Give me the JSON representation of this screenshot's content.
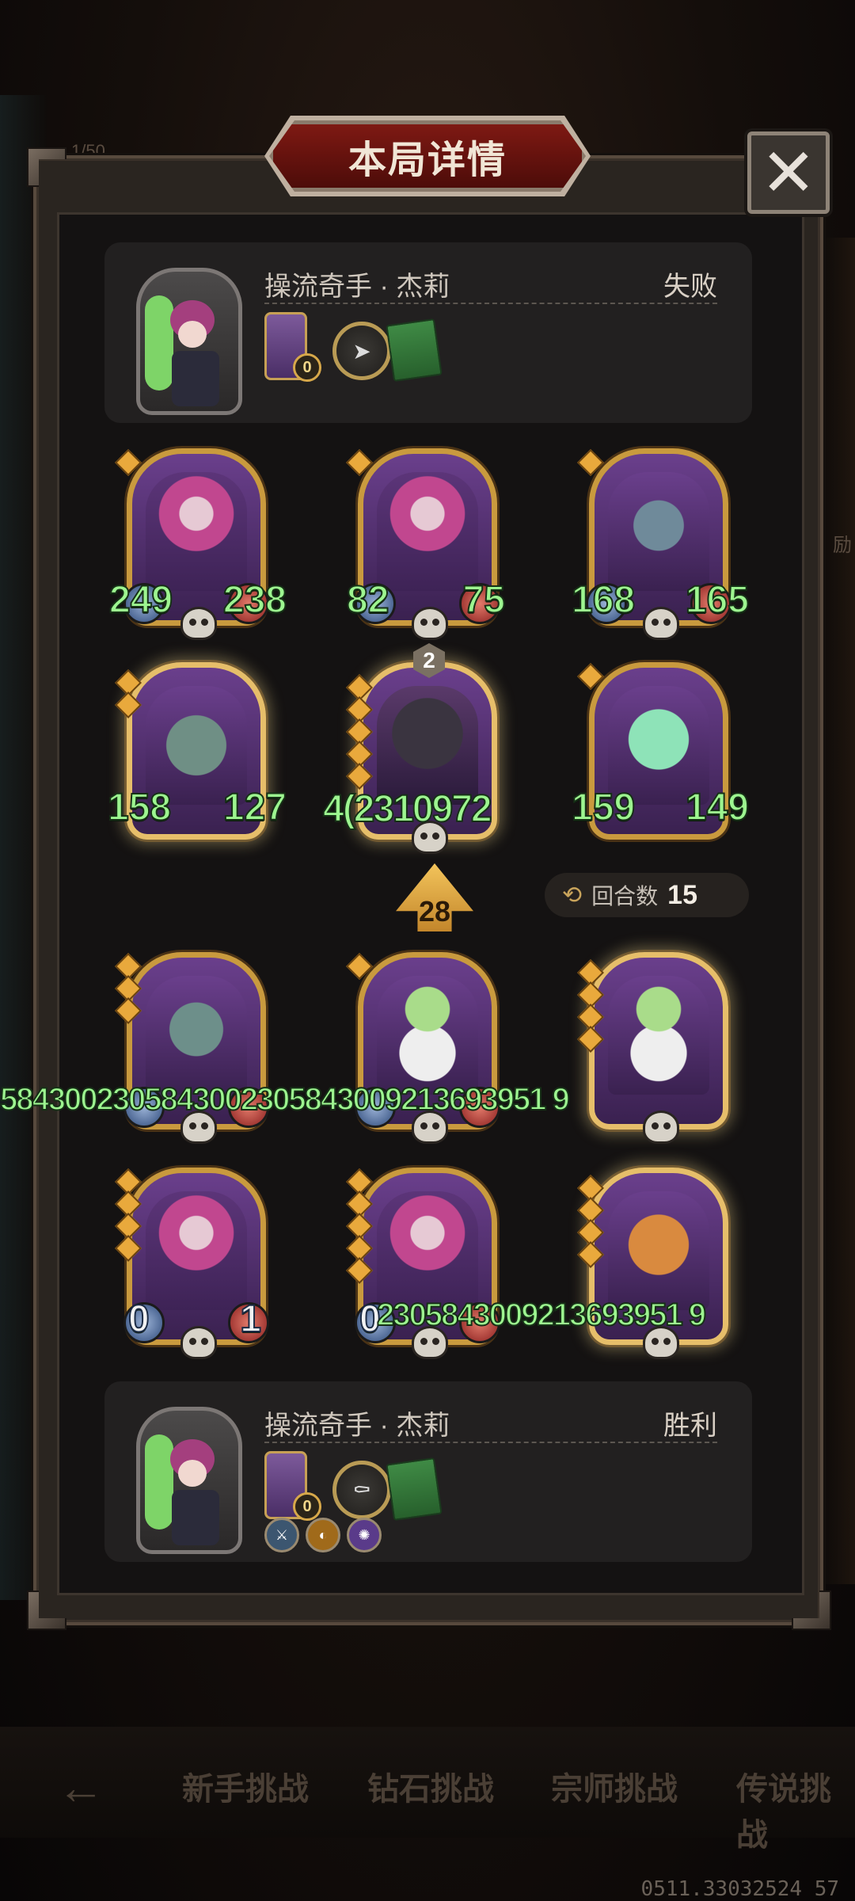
{
  "title": "本局详情",
  "close_icon": "✕",
  "top_player": {
    "name": "操流奇手 · 杰莉",
    "result": "失败",
    "mini_badge": "0"
  },
  "bottom_player": {
    "name": "操流奇手 · 杰莉",
    "result": "胜利",
    "mini_badge": "0"
  },
  "top_row1": [
    {
      "atk": "249",
      "hp": "238"
    },
    {
      "atk": "82",
      "hp": "75"
    },
    {
      "atk": "168",
      "hp": "165"
    }
  ],
  "top_row2": [
    {
      "atk": "158",
      "hp": "127"
    },
    {
      "tier": "2",
      "overflow": "4(2310972"
    },
    {
      "atk": "159",
      "hp": "149"
    }
  ],
  "arrow_count": "28",
  "rounds": {
    "label": "回合数",
    "value": "15"
  },
  "bottom_row1_overflow": "5843002305843002305843009213693951 9",
  "bottom_row2": [
    {
      "atk": "0",
      "hp": "1"
    },
    {
      "atk": "0"
    }
  ],
  "bottom_row2_overflow": "2305843009213693951 9",
  "nav": [
    "新手挑战",
    "钻石挑战",
    "宗师挑战",
    "传说挑战"
  ],
  "bg_top_text": "1/50",
  "bg_side_text": "励",
  "footer_number": "0511.33032524 57",
  "colors": {
    "stat_green": "#9df590",
    "frame_gold": "#c99a3e",
    "banner_red": "#7e1913"
  }
}
